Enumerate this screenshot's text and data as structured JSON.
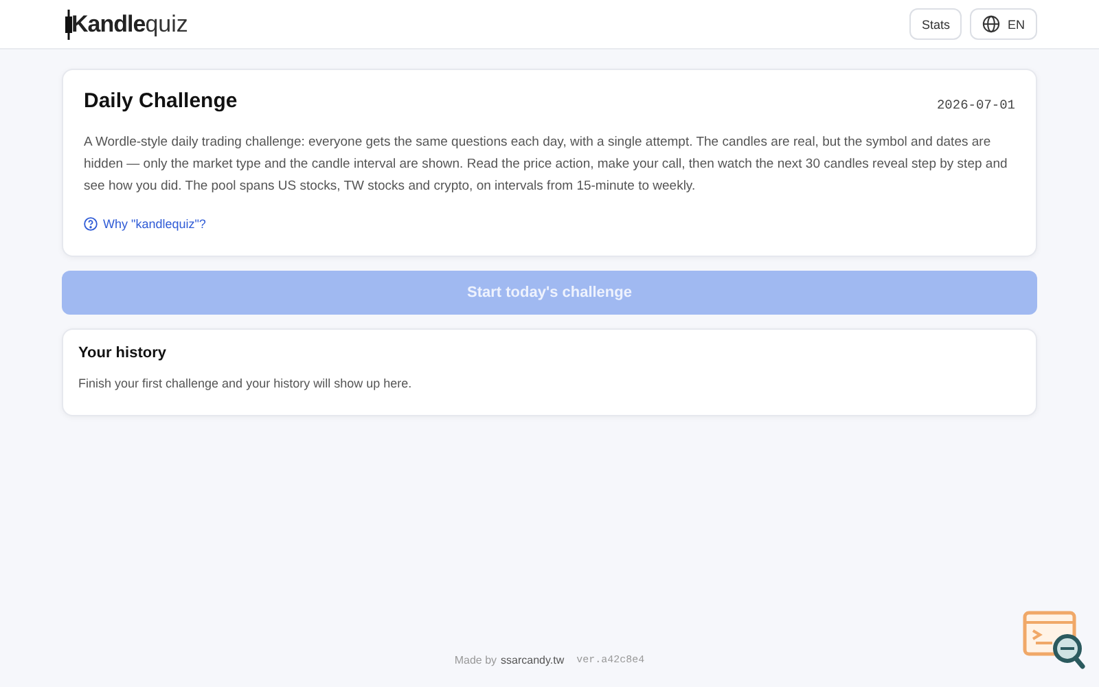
{
  "header": {
    "logo": {
      "bold": "Kandle",
      "light": "quiz"
    },
    "buttons": [
      {
        "kind": "text",
        "label": "Stats"
      },
      {
        "kind": "language",
        "label": "EN"
      }
    ]
  },
  "challenge": {
    "title": "Daily Challenge",
    "date": "2026-07-01",
    "description": "A Wordle-style daily trading challenge: everyone gets the same questions each day, with a single attempt. The candles are real, but the symbol and dates are hidden — only the market type and the candle interval are shown. Read the price action, make your call, then watch the next 30 candles reveal step by step and see how you did. The pool spans US stocks, TW stocks and crypto, on intervals from 15-minute to weekly.",
    "link": "Why \"kandlequiz\"?"
  },
  "start_button": {
    "label": "Start today's challenge",
    "disabled": true
  },
  "history": {
    "title": "Your history",
    "message": "Finish your first challenge and your history will show up here."
  },
  "footer": {
    "made_by": "Made by",
    "author": "ssarcandy.tw",
    "version": "ver.a42c8e4"
  }
}
